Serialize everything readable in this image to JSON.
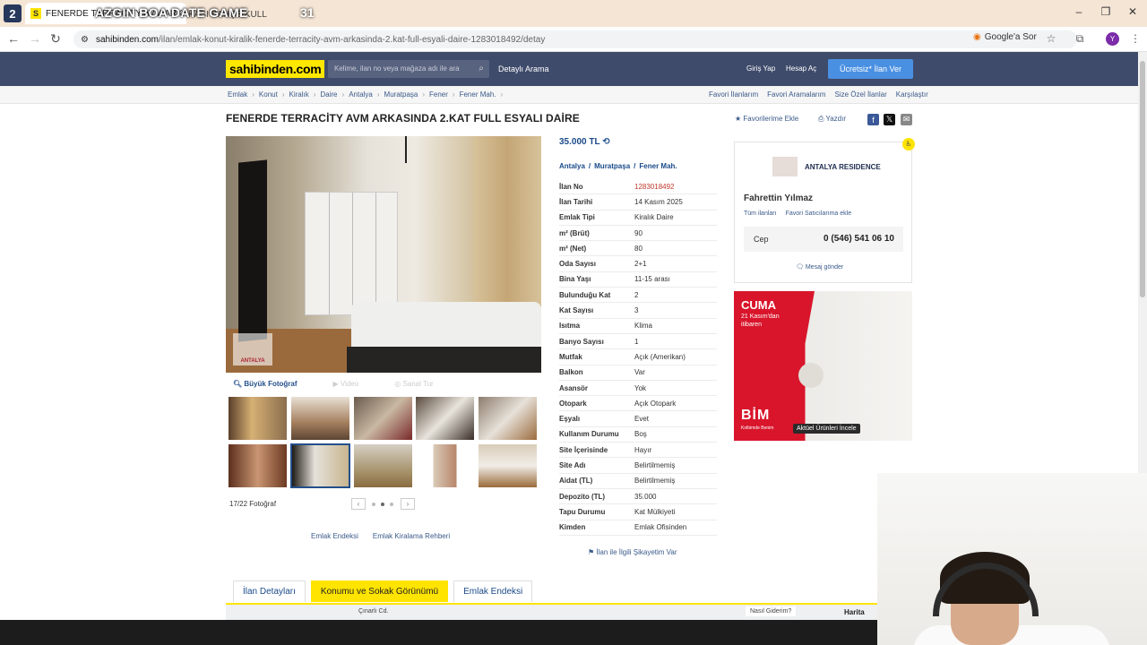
{
  "browser": {
    "tab_badge": "2",
    "tab_title": "FENERDE TERRACITY AVM ARKASINDA",
    "tab2_title": "KASI BAHÇE KULL",
    "stream_title": "AZGIN BOA DATE GAME",
    "stream_num": "31",
    "url_domain": "sahibinden.com",
    "url_path": "/ilan/emlak-konut-kiralik-fenerde-terracity-avm-arkasinda-2.kat-full-esyali-daire-1283018492/detay",
    "google_sor": "Google'a Sor",
    "avatar": "Y"
  },
  "site": {
    "logo": "sahibinden.com",
    "search_placeholder": "Kelime, ilan no veya mağaza adı ile ara",
    "detayli_arama": "Detaylı Arama",
    "giris": "Giriş Yap",
    "hesap": "Hesap Aç",
    "ucretsiz": "Ücretsiz* İlan Ver"
  },
  "breadcrumbs": [
    "Emlak",
    "Konut",
    "Kiralık",
    "Daire",
    "Antalya",
    "Muratpaşa",
    "Fener",
    "Fener Mah."
  ],
  "crumb_right": [
    "Favori İlanlarım",
    "Favori Aramalarım",
    "Size Özel İlanlar",
    "Karşılaştır"
  ],
  "listing": {
    "title": "FENERDE TERRACİTY AVM ARKASINDA 2.KAT FULL ESYALI DAİRE",
    "fav": "Favorilerime Ekle",
    "print": "Yazdır",
    "price": "35.000 TL",
    "location": [
      "Antalya",
      "/",
      "Muratpaşa",
      "/",
      "Fener Mah."
    ],
    "big_photo": "Büyük Fotoğraf",
    "video": "Video",
    "sanal_tur": "Sanal Tur",
    "pager": "17/22 Fotoğraf",
    "links": [
      "Emlak Endeksi",
      "Emlak Kiralama Rehberi"
    ],
    "complain": "İlan ile İlgili Şikayetim Var"
  },
  "details": [
    {
      "k": "İlan No",
      "v": "1283018492",
      "red": true
    },
    {
      "k": "İlan Tarihi",
      "v": "14 Kasım 2025"
    },
    {
      "k": "Emlak Tipi",
      "v": "Kiralık Daire"
    },
    {
      "k": "m² (Brüt)",
      "v": "90"
    },
    {
      "k": "m² (Net)",
      "v": "80"
    },
    {
      "k": "Oda Sayısı",
      "v": "2+1"
    },
    {
      "k": "Bina Yaşı",
      "v": "11-15 arası"
    },
    {
      "k": "Bulunduğu Kat",
      "v": "2"
    },
    {
      "k": "Kat Sayısı",
      "v": "3"
    },
    {
      "k": "Isıtma",
      "v": "Klima"
    },
    {
      "k": "Banyo Sayısı",
      "v": "1"
    },
    {
      "k": "Mutfak",
      "v": "Açık (Amerikan)"
    },
    {
      "k": "Balkon",
      "v": "Var"
    },
    {
      "k": "Asansör",
      "v": "Yok"
    },
    {
      "k": "Otopark",
      "v": "Açık Otopark"
    },
    {
      "k": "Eşyalı",
      "v": "Evet"
    },
    {
      "k": "Kullanım Durumu",
      "v": "Boş"
    },
    {
      "k": "Site İçerisinde",
      "v": "Hayır"
    },
    {
      "k": "Site Adı",
      "v": "Belirtilmemiş"
    },
    {
      "k": "Aidat (TL)",
      "v": "Belirtilmemiş"
    },
    {
      "k": "Depozito (TL)",
      "v": "35.000"
    },
    {
      "k": "Tapu Durumu",
      "v": "Kat Mülkiyeti"
    },
    {
      "k": "Kimden",
      "v": "Emlak Ofisinden"
    }
  ],
  "seller": {
    "name": "ANTALYA RESIDENCE",
    "agent": "Fahrettin Yılmaz",
    "all_listings": "Tüm ilanları",
    "fav_seller": "Favori Satıcılarıma ekle",
    "phone_label": "Cep",
    "phone": "0 (546) 541 06 10",
    "message": "Mesaj gönder"
  },
  "ad": {
    "cuma": "CUMA",
    "sub": "21 Kasım'dan itibaren",
    "bim": "BİM",
    "bim_sub": "Kolbimde Benim",
    "btn": "Aktüel Ürünleri İncele"
  },
  "bottom_tabs": [
    "İlan Detayları",
    "Konumu ve Sokak Görünümü",
    "Emlak Endeksi"
  ],
  "map": {
    "street": "Çınarlı Cd.",
    "street_btn": "Nasıl Giderim?",
    "harita": "Harita"
  }
}
